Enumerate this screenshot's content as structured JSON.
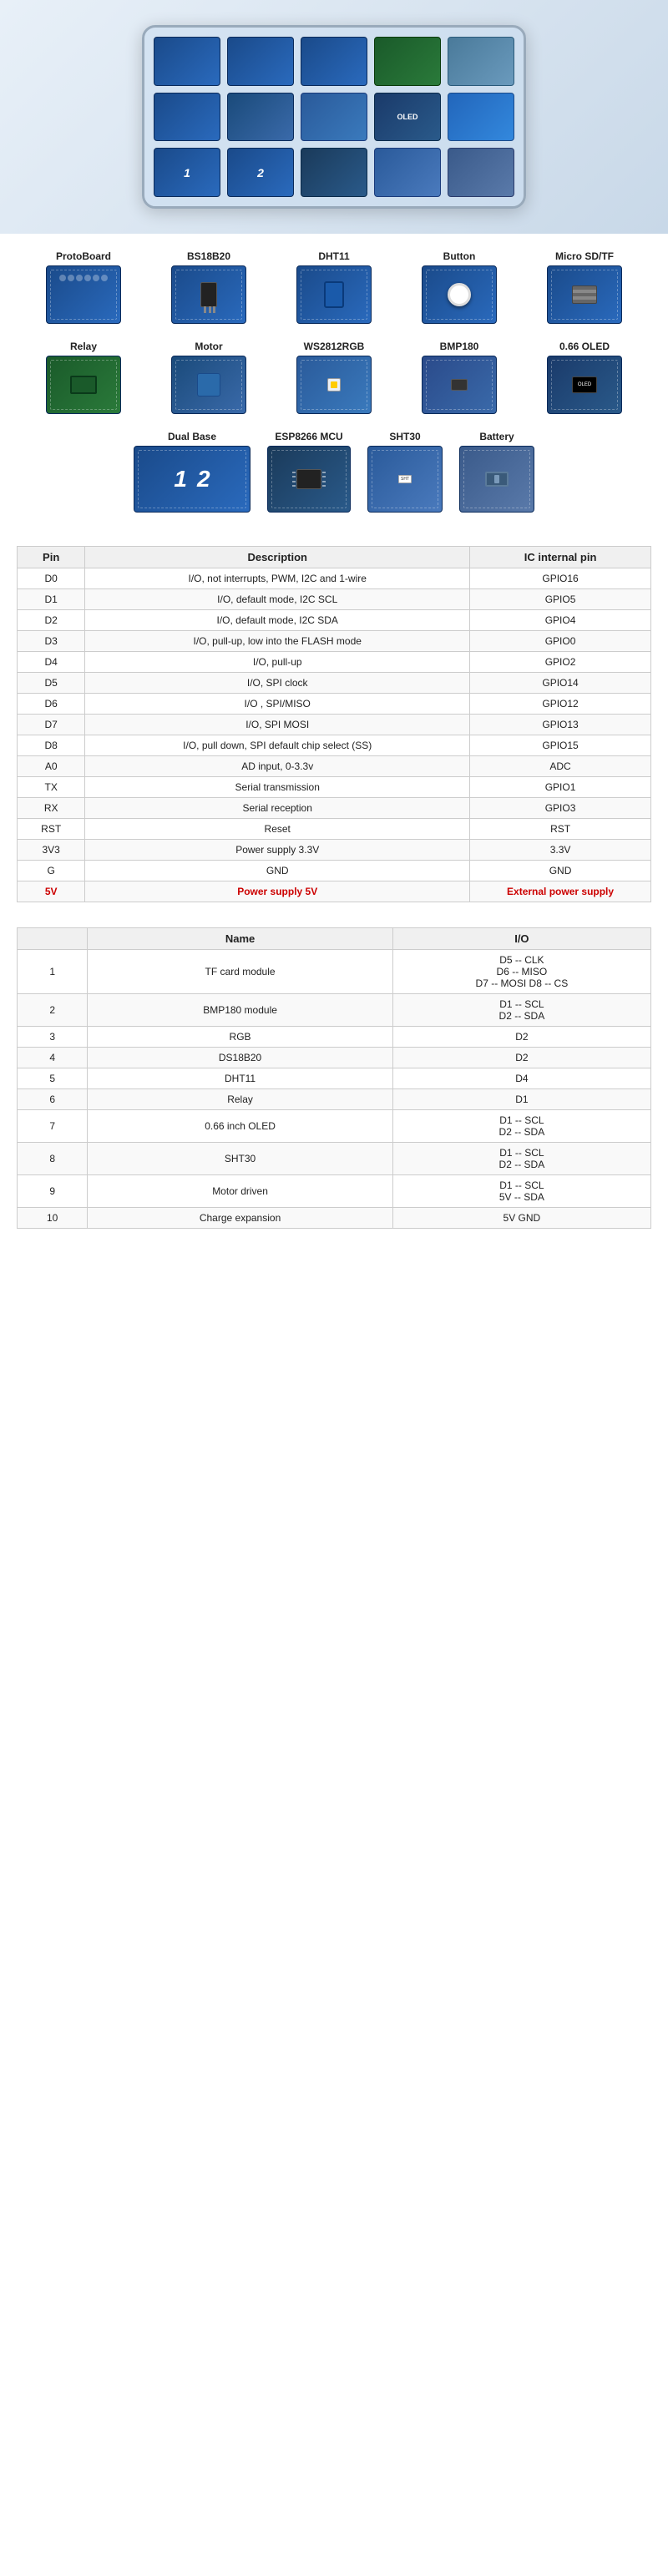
{
  "hero": {
    "alt": "ESP8266 D1 Mini Shield Kit in plastic case"
  },
  "component_rows": [
    {
      "items": [
        {
          "label": "ProtoBoard",
          "style": ""
        },
        {
          "label": "BS18B20",
          "style": ""
        },
        {
          "label": "DHT11",
          "style": ""
        },
        {
          "label": "Button",
          "style": ""
        },
        {
          "label": "Micro SD/TF",
          "style": ""
        }
      ]
    },
    {
      "items": [
        {
          "label": "Relay",
          "style": "relay-img"
        },
        {
          "label": "Motor",
          "style": "motor-img"
        },
        {
          "label": "WS2812RGB",
          "style": "rgb-img"
        },
        {
          "label": "BMP180",
          "style": "bmp-img"
        },
        {
          "label": "0.66 OLED",
          "style": "oled-img"
        }
      ]
    },
    {
      "items": [
        {
          "label": "Dual Base",
          "style": "dual-img",
          "wide": true
        },
        {
          "label": "ESP8266 MCU",
          "style": "mcu-img"
        },
        {
          "label": "SHT30",
          "style": "sht-img"
        },
        {
          "label": "Battery",
          "style": "battery-img"
        }
      ]
    }
  ],
  "pin_table": {
    "headers": [
      "Pin",
      "Description",
      "IC internal pin"
    ],
    "rows": [
      {
        "pin": "D0",
        "desc": "I/O,  not interrupts, PWM, I2C and 1-wire",
        "ic": "GPIO16",
        "red": false
      },
      {
        "pin": "D1",
        "desc": "I/O, default mode, I2C SCL",
        "ic": "GPIO5",
        "red": false
      },
      {
        "pin": "D2",
        "desc": "I/O, default mode, I2C SDA",
        "ic": "GPIO4",
        "red": false
      },
      {
        "pin": "D3",
        "desc": "I/O, pull-up, low into the FLASH mode",
        "ic": "GPIO0",
        "red": false
      },
      {
        "pin": "D4",
        "desc": "I/O, pull-up",
        "ic": "GPIO2",
        "red": false
      },
      {
        "pin": "D5",
        "desc": "I/O, SPI clock",
        "ic": "GPIO14",
        "red": false
      },
      {
        "pin": "D6",
        "desc": "I/O , SPI‎/MISO",
        "ic": "GPIO12",
        "red": false
      },
      {
        "pin": "D7",
        "desc": "I/O, SPI MOSI",
        "ic": "GPIO13",
        "red": false
      },
      {
        "pin": "D8",
        "desc": "I/O, pull down, SPI  default chip select (SS)",
        "ic": "GPIO15",
        "red": false
      },
      {
        "pin": "A0",
        "desc": "AD input, 0-3.3v",
        "ic": "ADC",
        "red": false
      },
      {
        "pin": "TX",
        "desc": "Serial transmission",
        "ic": "GPIO1",
        "red": false
      },
      {
        "pin": "RX",
        "desc": "Serial reception",
        "ic": "GPIO3",
        "red": false
      },
      {
        "pin": "RST",
        "desc": "Reset",
        "ic": "RST",
        "red": false
      },
      {
        "pin": "3V3",
        "desc": "Power supply 3.3V",
        "ic": "3.3V",
        "red": false
      },
      {
        "pin": "G",
        "desc": "GND",
        "ic": "GND",
        "red": false
      },
      {
        "pin": "5V",
        "desc": "Power supply 5V",
        "ic": "External power supply",
        "red": true
      }
    ]
  },
  "module_table": {
    "headers": [
      "",
      "Name",
      "I/O"
    ],
    "rows": [
      {
        "num": "1",
        "name": "TF card module",
        "io": "D5 -- CLK\nD6 -- MISO\nD7 -- MOSI D8 -- CS"
      },
      {
        "num": "2",
        "name": "BMP180 module",
        "io": "D1 -- SCL\nD2 -- SDA"
      },
      {
        "num": "3",
        "name": "RGB",
        "io": "D2"
      },
      {
        "num": "4",
        "name": "DS18B20",
        "io": "D2"
      },
      {
        "num": "5",
        "name": "DHT11",
        "io": "D4"
      },
      {
        "num": "6",
        "name": "Relay",
        "io": "D1"
      },
      {
        "num": "7",
        "name": "0.66 inch OLED",
        "io": "D1 -- SCL\nD2 -- SDA"
      },
      {
        "num": "8",
        "name": "SHT30",
        "io": "D1 -- SCL\nD2 -- SDA"
      },
      {
        "num": "9",
        "name": "Motor driven",
        "io": "D1 -- SCL\n5V -- SDA"
      },
      {
        "num": "10",
        "name": "Charge expansion",
        "io": "5V GND"
      }
    ]
  }
}
